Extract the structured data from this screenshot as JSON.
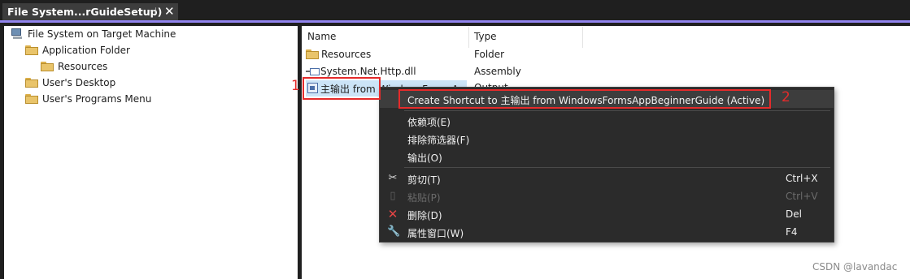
{
  "window": {
    "tab_title": "File System...rGuideSetup)",
    "pin_glyph": "⊣",
    "close_glyph": "✕"
  },
  "tree": {
    "items": [
      {
        "label": "File System on Target Machine",
        "icon": "computer-icon"
      },
      {
        "label": "Application Folder",
        "icon": "folder-icon"
      },
      {
        "label": "Resources",
        "icon": "folder-icon"
      },
      {
        "label": "User's Desktop",
        "icon": "folder-icon"
      },
      {
        "label": "User's Programs Menu",
        "icon": "folder-icon"
      }
    ]
  },
  "list": {
    "columns": [
      "Name",
      "Type"
    ],
    "rows": [
      {
        "name": "Resources",
        "type": "Folder",
        "icon": "folder-icon"
      },
      {
        "name": "System.Net.Http.dll",
        "type": "Assembly",
        "icon": "assembly-icon"
      },
      {
        "name": "主输出 from WindowsFormsAp",
        "type": "Output",
        "icon": "project-output-icon",
        "selected": true
      }
    ]
  },
  "annotations": {
    "marker_1": "1",
    "marker_2": "2",
    "color": "#e52b2b"
  },
  "context_menu": {
    "items": [
      {
        "label": "Create Shortcut to 主输出 from WindowsFormsAppBeginnerGuide (Active)",
        "shortcut": "",
        "icon": "",
        "enabled": true,
        "highlighted": true
      },
      {
        "label": "依赖项(E)",
        "shortcut": "",
        "icon": "",
        "enabled": true
      },
      {
        "label": "排除筛选器(F)",
        "shortcut": "",
        "icon": "",
        "enabled": true
      },
      {
        "label": "输出(O)",
        "shortcut": "",
        "icon": "",
        "enabled": true
      },
      {
        "label": "剪切(T)",
        "shortcut": "Ctrl+X",
        "icon": "scissors-icon",
        "enabled": true
      },
      {
        "label": "粘贴(P)",
        "shortcut": "Ctrl+V",
        "icon": "clipboard-icon",
        "enabled": false
      },
      {
        "label": "删除(D)",
        "shortcut": "Del",
        "icon": "delete-x-icon",
        "enabled": true
      },
      {
        "label": "属性窗口(W)",
        "shortcut": "F4",
        "icon": "wrench-icon",
        "enabled": true
      }
    ]
  },
  "watermark": "CSDN @lavandac",
  "colors": {
    "accent": "#9184ee",
    "menu_bg": "#2b2b2b",
    "selection": "#cce4f7"
  }
}
